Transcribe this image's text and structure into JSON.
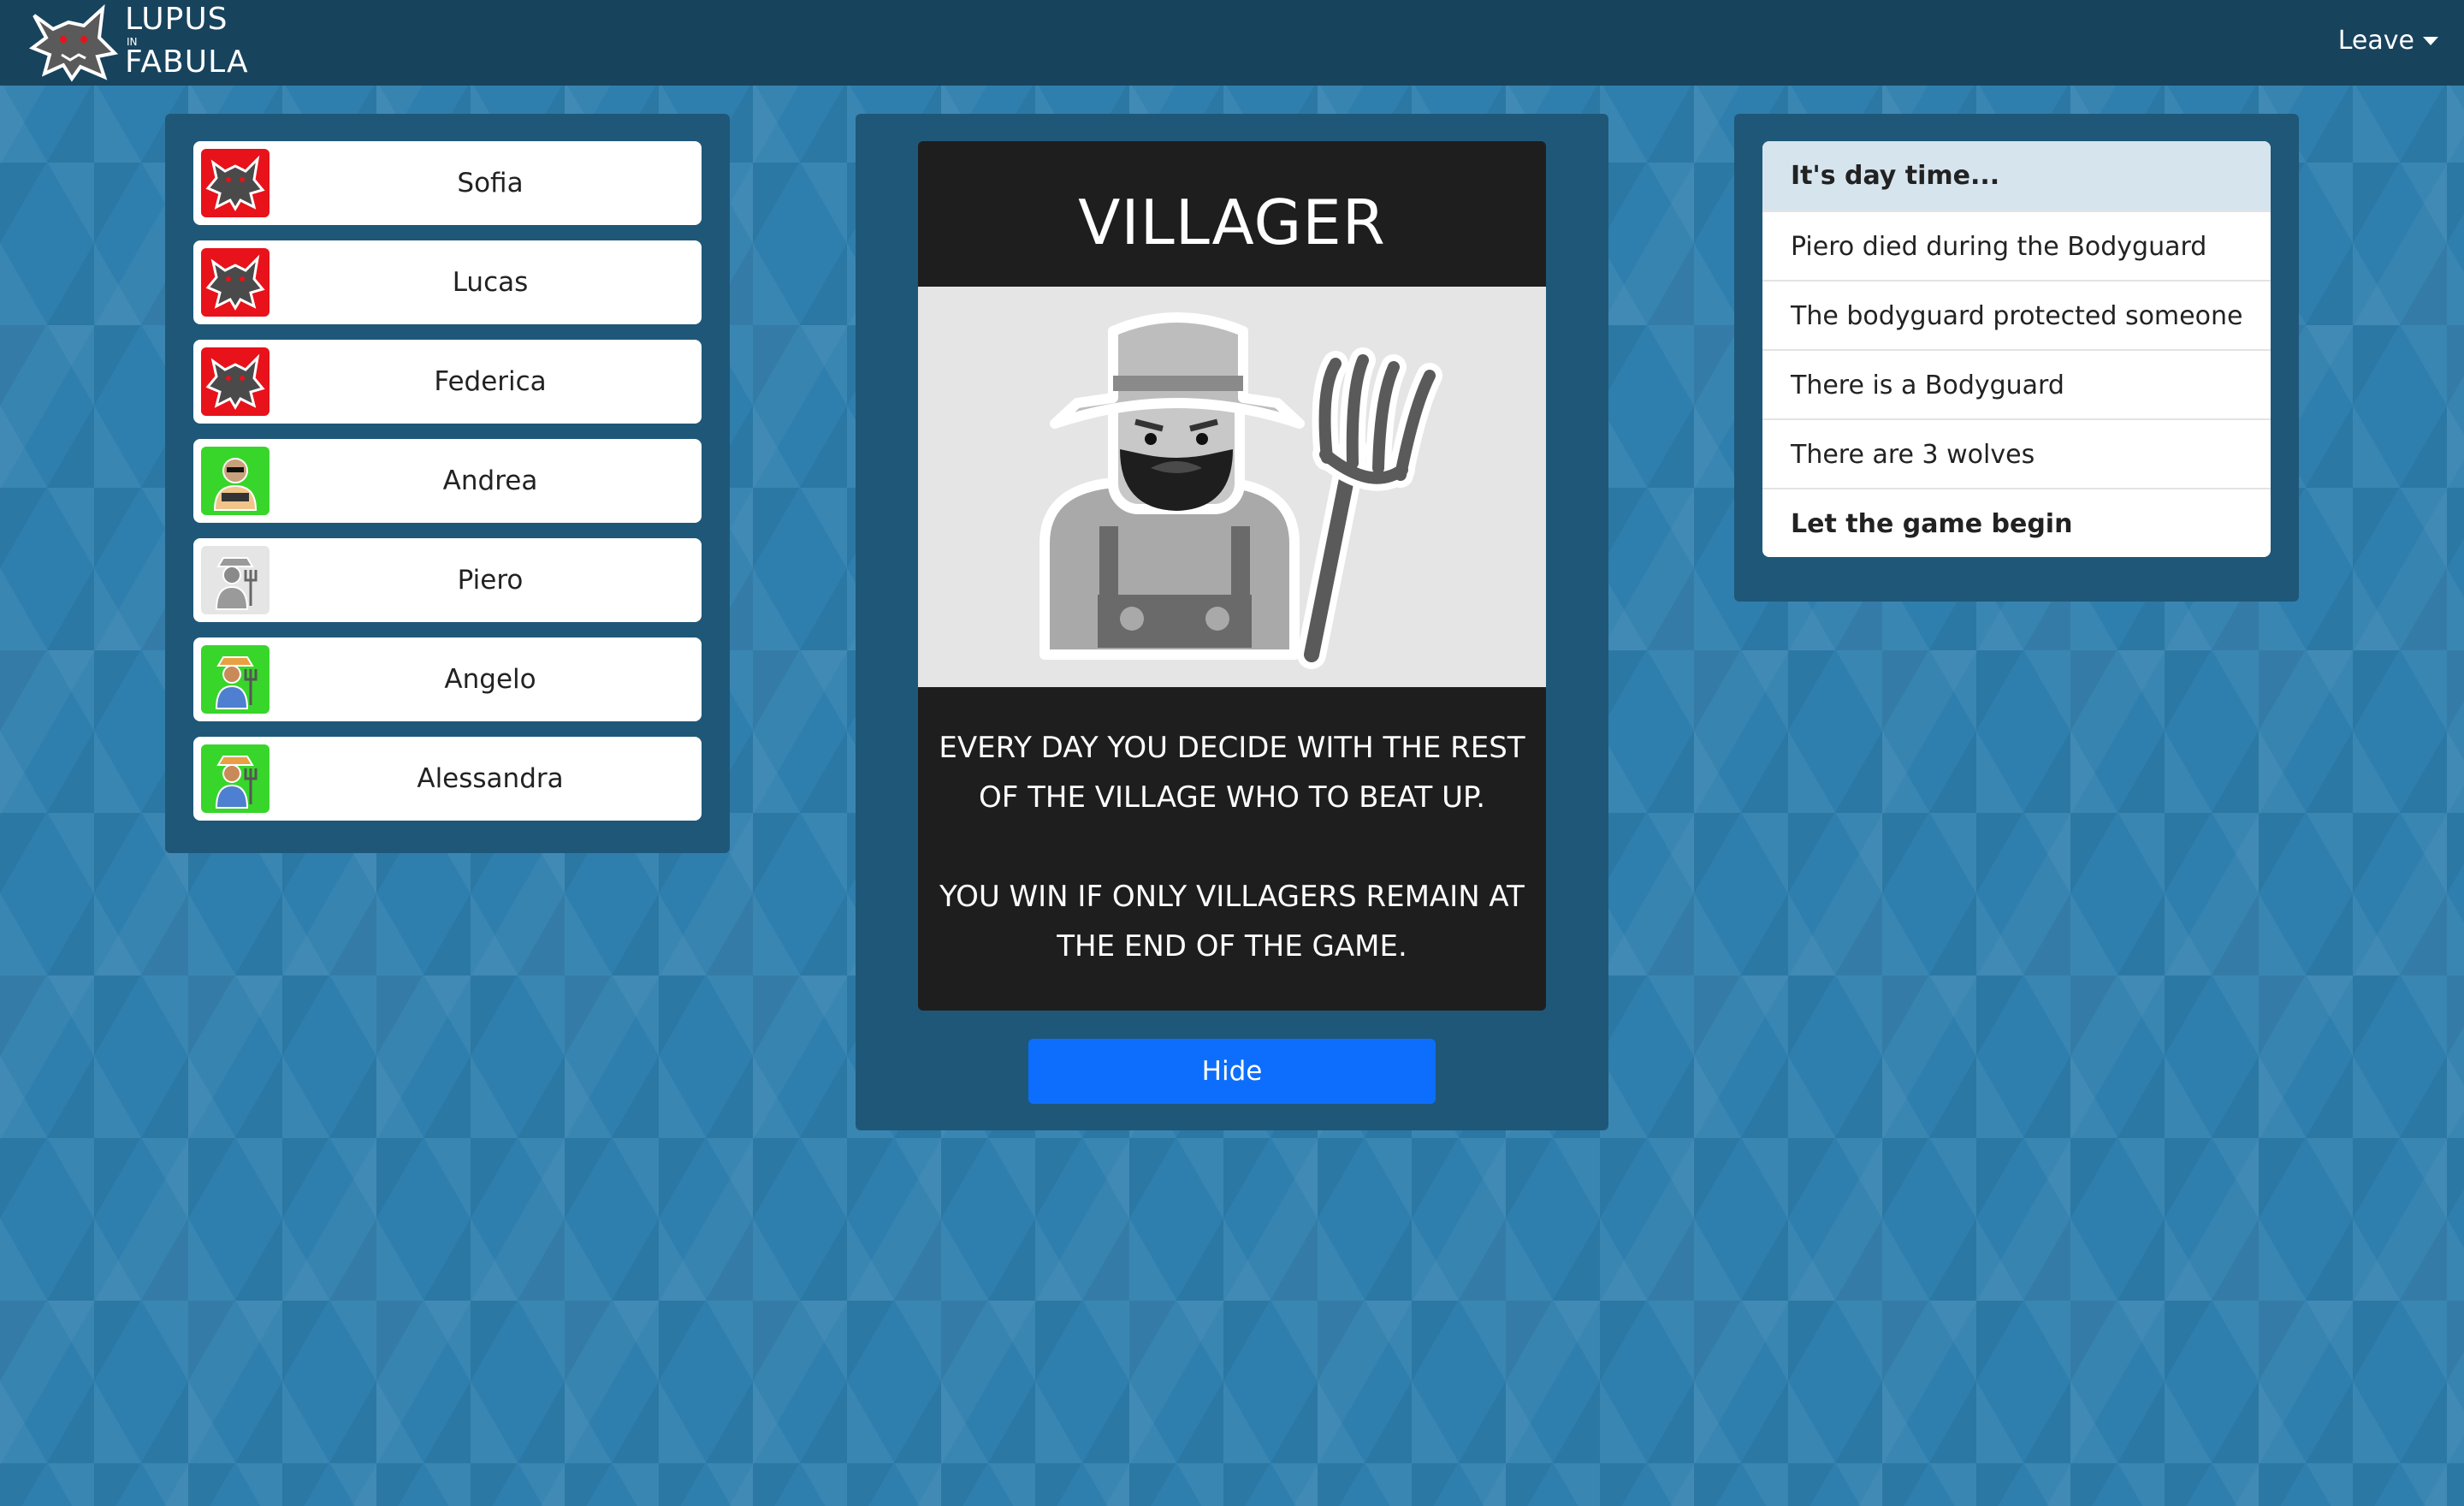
{
  "nav": {
    "brand_line1": "LUPUS",
    "brand_line2": "IN",
    "brand_line3": "FABULA",
    "leave_label": "Leave"
  },
  "players": [
    {
      "name": "Sofia",
      "role_icon": "wolf-icon"
    },
    {
      "name": "Lucas",
      "role_icon": "wolf-icon"
    },
    {
      "name": "Federica",
      "role_icon": "wolf-icon"
    },
    {
      "name": "Andrea",
      "role_icon": "bodyguard-icon"
    },
    {
      "name": "Piero",
      "role_icon": "dead-villager-icon"
    },
    {
      "name": "Angelo",
      "role_icon": "villager-icon"
    },
    {
      "name": "Alessandra",
      "role_icon": "villager-icon"
    }
  ],
  "card": {
    "title": "VILLAGER",
    "description_1": "EVERY DAY YOU DECIDE WITH THE REST OF THE VILLAGE WHO TO BEAT UP.",
    "description_2": "YOU WIN IF ONLY VILLAGERS REMAIN AT THE END OF THE GAME.",
    "hide_label": "Hide"
  },
  "log": [
    "It's day time...",
    "Piero died during the Bodyguard",
    "The bodyguard protected someone",
    "There is a Bodyguard",
    "There are 3 wolves",
    "Let the game begin"
  ],
  "colors": {
    "navbar": "#17435d",
    "panel": "#1f5778",
    "wolf_badge": "#e8121b",
    "villager_badge": "#38d62a",
    "primary_button": "#0d6efd"
  }
}
